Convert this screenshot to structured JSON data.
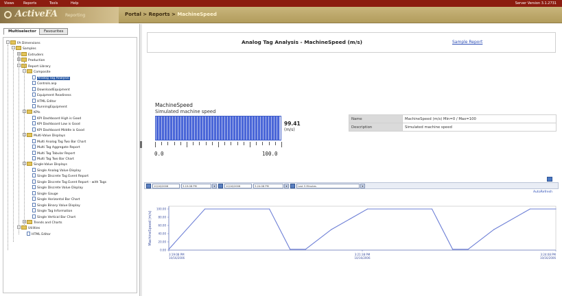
{
  "menu": {
    "items": [
      "Views",
      "Reports",
      "Tools",
      "Help"
    ],
    "version": "Server Version 3.1.2731"
  },
  "header": {
    "logo_text": "ActiveFA",
    "logo_sub": "Reporting",
    "breadcrumb": {
      "portal": "Portal",
      "reports": "Reports",
      "current": "MachineSpeed",
      "sep": " > "
    }
  },
  "tabs": [
    {
      "label": "Multiselector"
    },
    {
      "label": "Favourites"
    }
  ],
  "tree": [
    {
      "label": "FA Dimensions",
      "depth": 0,
      "expander": "-",
      "icon": "folder"
    },
    {
      "label": "Samples",
      "depth": 1,
      "expander": "-",
      "icon": "folder"
    },
    {
      "label": "Extruders",
      "depth": 2,
      "expander": "+",
      "icon": "folder"
    },
    {
      "label": "Production",
      "depth": 2,
      "expander": "+",
      "icon": "folder"
    },
    {
      "label": "Report Library",
      "depth": 2,
      "expander": "-",
      "icon": "folder"
    },
    {
      "label": "Composite",
      "depth": 3,
      "expander": "-",
      "icon": "folder"
    },
    {
      "label": "Analog Tag Analysis",
      "depth": 4,
      "expander": "",
      "icon": "doc",
      "selected": true
    },
    {
      "label": "Controls.asp",
      "depth": 4,
      "expander": "",
      "icon": "doc"
    },
    {
      "label": "DownloadEquipment",
      "depth": 4,
      "expander": "",
      "icon": "doc"
    },
    {
      "label": "Equipment Readiness",
      "depth": 4,
      "expander": "",
      "icon": "doc"
    },
    {
      "label": "HTML Editor",
      "depth": 4,
      "expander": "",
      "icon": "doc"
    },
    {
      "label": "RunningEquipment",
      "depth": 4,
      "expander": "",
      "icon": "doc"
    },
    {
      "label": "KPIs",
      "depth": 3,
      "expander": "-",
      "icon": "folder"
    },
    {
      "label": "KPI Dashboard High is Good",
      "depth": 4,
      "expander": "",
      "icon": "doc"
    },
    {
      "label": "KPI Dashboard Low is Good",
      "depth": 4,
      "expander": "",
      "icon": "doc"
    },
    {
      "label": "KPI Dashboard Middle is Good",
      "depth": 4,
      "expander": "",
      "icon": "doc"
    },
    {
      "label": "Multi-Value Displays",
      "depth": 3,
      "expander": "-",
      "icon": "folder"
    },
    {
      "label": "Multi Analog Tag Two Bar Chart",
      "depth": 4,
      "expander": "",
      "icon": "doc"
    },
    {
      "label": "Multi Tag Aggregate Report",
      "depth": 4,
      "expander": "",
      "icon": "doc"
    },
    {
      "label": "Multi Tag Tabular Report",
      "depth": 4,
      "expander": "",
      "icon": "doc"
    },
    {
      "label": "Multi Tag Two Bar Chart",
      "depth": 4,
      "expander": "",
      "icon": "doc"
    },
    {
      "label": "Single-Value Displays",
      "depth": 3,
      "expander": "-",
      "icon": "folder"
    },
    {
      "label": "Single Analog Value Display",
      "depth": 4,
      "expander": "",
      "icon": "doc"
    },
    {
      "label": "Single Discrete Tag Event Report",
      "depth": 4,
      "expander": "",
      "icon": "doc"
    },
    {
      "label": "Single Discrete Tag Event Report - with Tags",
      "depth": 4,
      "expander": "",
      "icon": "doc"
    },
    {
      "label": "Single Discrete Value Display",
      "depth": 4,
      "expander": "",
      "icon": "doc"
    },
    {
      "label": "Single Gauge",
      "depth": 4,
      "expander": "",
      "icon": "doc"
    },
    {
      "label": "Single Horizontal Bar Chart",
      "depth": 4,
      "expander": "",
      "icon": "doc"
    },
    {
      "label": "Single Binary Value Display",
      "depth": 4,
      "expander": "",
      "icon": "doc"
    },
    {
      "label": "Single Tag Information",
      "depth": 4,
      "expander": "",
      "icon": "doc"
    },
    {
      "label": "Single Vertical Bar Chart",
      "depth": 4,
      "expander": "",
      "icon": "doc"
    },
    {
      "label": "Trends and Charts",
      "depth": 3,
      "expander": "+",
      "icon": "folder"
    },
    {
      "label": "Utilities",
      "depth": 2,
      "expander": "-",
      "icon": "folder"
    },
    {
      "label": "HTML Editor",
      "depth": 3,
      "expander": "",
      "icon": "doc"
    }
  ],
  "report": {
    "title": "Analog Tag Analysis - MachineSpeed (m/s)",
    "sample_link": "Sample Report"
  },
  "tag": {
    "name": "MachineSpeed",
    "description": "Simulated machine speed",
    "value": 99.41,
    "value_text": "99.41",
    "unit": "(m/s)",
    "min_label": "0.0",
    "max_label": "100.0",
    "min": 0,
    "max": 100
  },
  "properties": [
    {
      "key": "Name",
      "value": "MachineSpeed (m/s) Min=0 / Max=100"
    },
    {
      "key": "Description",
      "value": "Simulated machine speed"
    }
  ],
  "toolbar": {
    "start_date": "10/16/2006",
    "start_time": "3:19:08 PM",
    "end_date": "10/16/2006",
    "end_time": "3:24:08 PM",
    "range": "Last 5 Minutes",
    "autorefresh": "AutoRefresh"
  },
  "chart_data": {
    "type": "line",
    "ylabel": "MachineSpeed (m/s)",
    "y_ticks": [
      "100.00",
      "80.00",
      "60.00",
      "40.00",
      "20.00",
      "0.00"
    ],
    "x_ticks": [
      {
        "time": "3:19:08 PM",
        "date": "10/16/2006"
      },
      {
        "time": "3:21:38 PM",
        "date": "10/16/2006"
      },
      {
        "time": "3:24:08 PM",
        "date": "10/16/2006"
      }
    ],
    "ylim": [
      0,
      100
    ],
    "xlim": [
      0,
      300
    ],
    "x_unit": "seconds since 3:19:08 PM",
    "series": [
      {
        "x": [
          0,
          28,
          78,
          94,
          106,
          126,
          154,
          204,
          220,
          232,
          252,
          280,
          300
        ],
        "values": [
          2,
          100,
          100,
          2,
          2,
          50,
          100,
          100,
          2,
          2,
          50,
          100,
          100
        ]
      }
    ]
  }
}
